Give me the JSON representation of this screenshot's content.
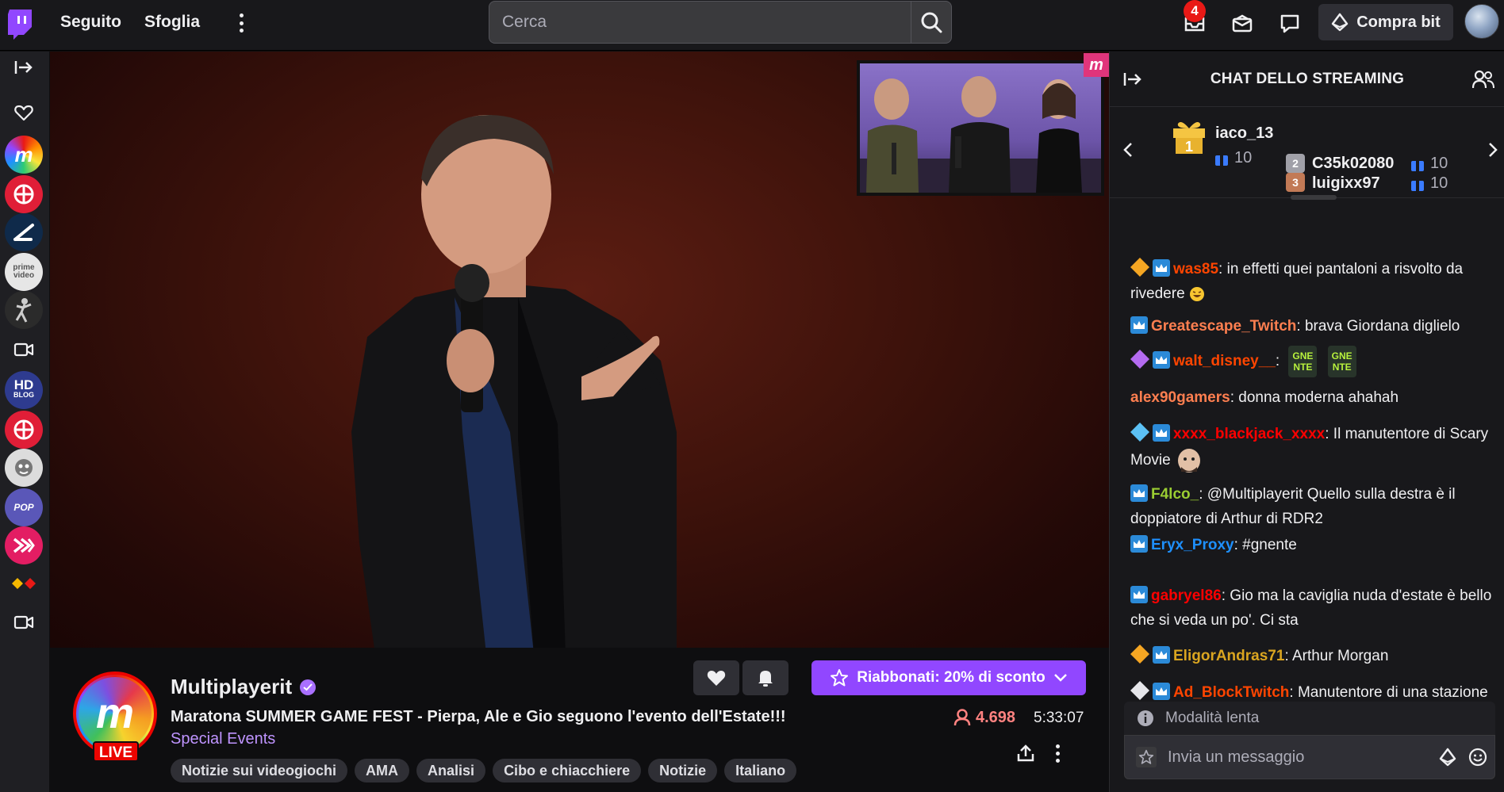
{
  "nav": {
    "following": "Seguito",
    "browse": "Sfoglia",
    "search_placeholder": "Cerca",
    "notifications_count": "4",
    "buy_bits": "Compra bit"
  },
  "channel": {
    "name": "Multiplayerit",
    "title": "Maratona SUMMER GAME FEST - Pierpa, Ale e Gio seguono l'evento dell'Estate!!!",
    "category": "Special Events",
    "live_label": "LIVE",
    "avatar_letter": "m",
    "subscribe_label": "Riabbonati: 20% di sconto",
    "viewers": "4.698",
    "uptime": "5:33:07",
    "tags": [
      "Notizie sui videogiochi",
      "AMA",
      "Analisi",
      "Cibo e chiacchiere",
      "Notizie",
      "Italiano"
    ]
  },
  "sidebar": {
    "prime_text": "prime video",
    "hd_text": "HD",
    "blog_text": "BLOG",
    "pop_text": "POP"
  },
  "chat": {
    "title": "CHAT DELLO STREAMING",
    "leaderboard": [
      {
        "rank": "1",
        "name": "iaco_13",
        "count": "10"
      },
      {
        "rank": "2",
        "name": "C35k02080",
        "count": "10"
      },
      {
        "rank": "3",
        "name": "luigixx97",
        "count": "10"
      }
    ],
    "messages": [
      {
        "user": "was85",
        "text": ": in effetti quei pantaloni a risvolto da rivedere",
        "color": "#ff4500"
      },
      {
        "user": "Greatescape_Twitch",
        "text": ": brava Giordana diglielo",
        "color": "#ff7f50"
      },
      {
        "user": "walt_disney__",
        "text": ":",
        "color": "#ff4500"
      },
      {
        "user": "alex90gamers",
        "text": ": donna moderna ahahah",
        "color": "#ff7f50"
      },
      {
        "user": "xxxx_blackjack_xxxx",
        "text": ": Il manutentore di Scary Movie",
        "color": "#ff0000"
      },
      {
        "user": "F4lco_",
        "text": ": @Multiplayerit Quello sulla destra è il doppiatore di Arthur di RDR2",
        "color": "#9acd32"
      },
      {
        "user": "Eryx_Proxy",
        "text": ": #gnente",
        "color": "#1e90ff"
      },
      {
        "user": "gabryel86",
        "text": ": Gio ma la caviglia nuda d'estate è bello che si veda un po'. Ci sta",
        "color": "#ff0000"
      },
      {
        "user": "EligorAndras71",
        "text": ": Arthur Morgan",
        "color": "#daa520"
      },
      {
        "user": "Ad_BlockTwitch",
        "text": ": Manutentore di una stazione spaziale, mai visto",
        "color": "#ff4500"
      }
    ],
    "emote_text": "GNE NTE",
    "slow_mode": "Modalità lenta",
    "input_placeholder": "Invia un messaggio"
  },
  "colors": {
    "brand": "#9147ff",
    "live": "#eb0400",
    "viewer_count": "#ff8280",
    "category": "#bf94ff"
  }
}
